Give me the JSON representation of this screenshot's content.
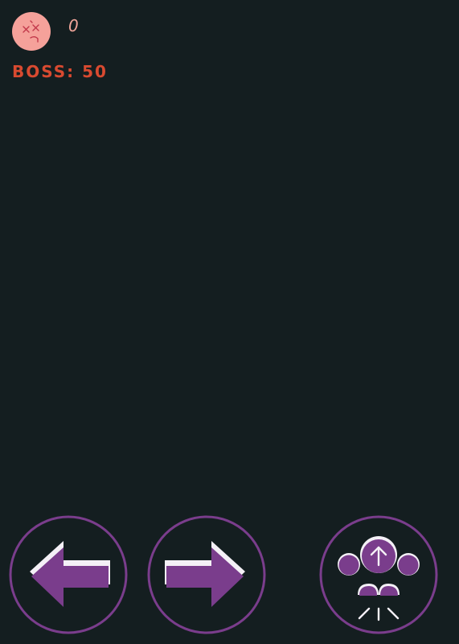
{
  "hud": {
    "face_icon": "dead-face-icon",
    "score": "0",
    "boss_label": "BOSS: 50"
  },
  "controls": {
    "left": {
      "icon": "arrow-left-icon"
    },
    "right": {
      "icon": "arrow-right-icon"
    },
    "jump": {
      "icon": "jump-icon"
    }
  },
  "colors": {
    "background": "#141e20",
    "face": "#f5a19a",
    "face_features": "#c2384a",
    "score_text": "#f0a59a",
    "boss_text": "#d94a30",
    "control_ring": "#7a3d8c",
    "control_fill": "#7a3d8c",
    "control_highlight": "#f4f0f6"
  }
}
